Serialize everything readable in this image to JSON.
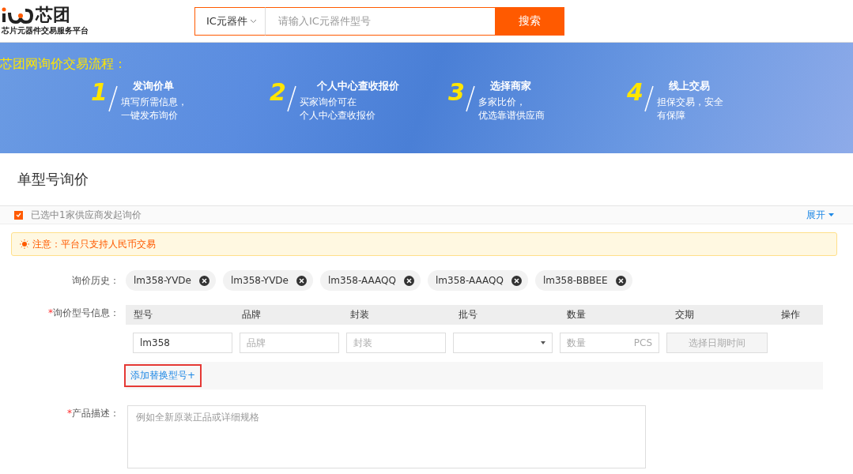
{
  "header": {
    "logo_text": "芯团",
    "logo_sub": "芯片元器件交易服务平台",
    "category": "IC元器件",
    "search_placeholder": "请输入IC元器件型号",
    "search_button": "搜索"
  },
  "banner": {
    "title": "芯团网询价交易流程：",
    "steps": [
      {
        "number": "1",
        "title": "发询价单",
        "lines": [
          "填写所需信息，",
          "一键发布询价"
        ]
      },
      {
        "number": "2",
        "title": "个人中心查收报价",
        "lines": [
          "买家询价可在",
          "个人中心查收报价"
        ]
      },
      {
        "number": "3",
        "title": "选择商家",
        "lines": [
          "多家比价，",
          "优选靠谱供应商"
        ]
      },
      {
        "number": "4",
        "title": "线上交易",
        "lines": [
          "担保交易，安全",
          "有保障"
        ]
      }
    ]
  },
  "section_title": "单型号询价",
  "supplier_bar": {
    "checked": true,
    "text": "已选中1家供应商发起询价",
    "expand": "展开"
  },
  "notice": "注意：平台只支持人民币交易",
  "history": {
    "label": "询价历史：",
    "tags": [
      "lm358-YVDe",
      "lm358-YVDe",
      "lm358-AAAQQ",
      "lm358-AAAQQ",
      "lm358-BBBEE"
    ]
  },
  "model_info": {
    "mark": "*",
    "label": "询价型号信息：",
    "columns": [
      "型号",
      "品牌",
      "封装",
      "批号",
      "数量",
      "交期",
      "操作"
    ],
    "row": {
      "model": "lm358",
      "brand_placeholder": "品牌",
      "package_placeholder": "封装",
      "quantity_placeholder": "数量",
      "unit": "PCS",
      "date_button": "选择日期时间"
    },
    "add_link": "添加替换型号+"
  },
  "description": {
    "mark": "*",
    "label": "产品描述：",
    "placeholder": "例如全新原装正品或详细规格"
  }
}
